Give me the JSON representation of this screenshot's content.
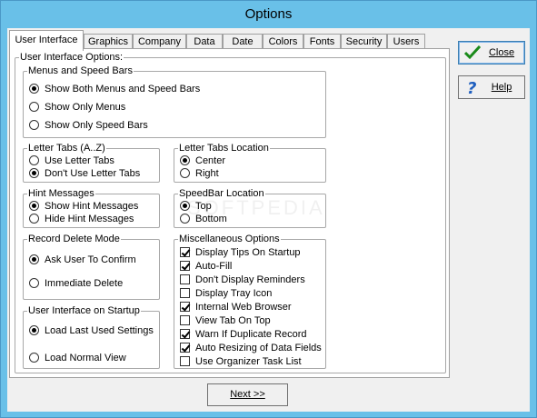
{
  "window": {
    "title": "Options"
  },
  "tabs": [
    "User Interface",
    "Graphics",
    "Company",
    "Data",
    "Date",
    "Colors",
    "Fonts",
    "Security",
    "Users"
  ],
  "panel": {
    "outer_legend": "User Interface Options:",
    "menus": {
      "legend": "Menus and Speed Bars",
      "options": [
        "Show Both Menus and Speed Bars",
        "Show Only Menus",
        "Show Only Speed Bars"
      ],
      "selected": 0
    },
    "letter_tabs": {
      "legend": "Letter Tabs (A..Z)",
      "options": [
        "Use Letter Tabs",
        "Don't Use Letter Tabs"
      ],
      "selected": 1
    },
    "letter_tabs_location": {
      "legend": "Letter Tabs Location",
      "options": [
        "Center",
        "Right"
      ],
      "selected": 0
    },
    "hint_messages": {
      "legend": "Hint Messages",
      "options": [
        "Show Hint Messages",
        "Hide Hint Messages"
      ],
      "selected": 0
    },
    "speedbar_location": {
      "legend": "SpeedBar Location",
      "options": [
        "Top",
        "Bottom"
      ],
      "selected": 0
    },
    "record_delete": {
      "legend": "Record Delete Mode",
      "options": [
        "Ask User To Confirm",
        "Immediate Delete"
      ],
      "selected": 0
    },
    "startup": {
      "legend": "User Interface on Startup",
      "options": [
        "Load Last Used Settings",
        "Load Normal View"
      ],
      "selected": 0
    },
    "misc": {
      "legend": "Miscellaneous Options",
      "options": [
        {
          "label": "Display Tips On Startup",
          "checked": true
        },
        {
          "label": "Auto-Fill",
          "checked": true
        },
        {
          "label": "Don't Display Reminders",
          "checked": false
        },
        {
          "label": "Display Tray Icon",
          "checked": false
        },
        {
          "label": "Internal Web Browser",
          "checked": true
        },
        {
          "label": "View Tab On Top",
          "checked": false
        },
        {
          "label": "Warn If Duplicate Record",
          "checked": true
        },
        {
          "label": "Auto Resizing of Data Fields",
          "checked": true
        },
        {
          "label": "Use Organizer Task List",
          "checked": false
        }
      ]
    }
  },
  "buttons": {
    "close": "Close",
    "help": "Help",
    "next": "Next >>"
  },
  "watermark": "SOFTPEDIA",
  "colors": {
    "titlebar": "#69c0e8",
    "close_check": "#1a8a1a",
    "help_question": "#1f5fbf"
  }
}
